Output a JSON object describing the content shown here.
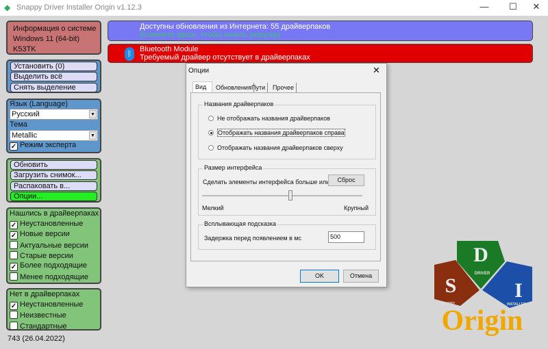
{
  "window": {
    "title": "Snappy Driver Installer Origin v1.12.3",
    "minimize": "—",
    "maximize": "☐",
    "close": "✕"
  },
  "sysinfo": {
    "title": "Информация о системе",
    "os": "Windows 11 (64-bit)",
    "model": "K53TK"
  },
  "selection": {
    "install": "Установить (0)",
    "select_all": "Выделить всё",
    "deselect": "Снять выделение"
  },
  "settings": {
    "language_label": "Язык (Language)",
    "language": "Русский",
    "theme_label": "Тема",
    "theme": "Metallic",
    "expert_mode": "Режим эксперта",
    "expert_checked": true
  },
  "actions": {
    "refresh": "Обновить",
    "load_snapshot": "Загрузить снимок...",
    "extract": "Распаковать в...",
    "options": "Опции..."
  },
  "found": {
    "title": "Нашлись в драйверпаках",
    "items": [
      {
        "label": "Неустановленные",
        "checked": true
      },
      {
        "label": "Новые версии",
        "checked": true
      },
      {
        "label": "Актуальные версии",
        "checked": false
      },
      {
        "label": "Старые версии",
        "checked": false
      },
      {
        "label": "Более подходящие",
        "checked": true
      },
      {
        "label": "Менее подходящие",
        "checked": false
      }
    ]
  },
  "notfound": {
    "title": "Нет в драйверпаках",
    "items": [
      {
        "label": "Неустановленные",
        "checked": true
      },
      {
        "label": "Неизвестные",
        "checked": false
      },
      {
        "label": "Стандартные",
        "checked": false
      }
    ]
  },
  "footer": {
    "revision": "743 (26.04.2022)"
  },
  "updates": {
    "line1": "Доступны обновления из Интернета: 55 драйверпаков",
    "line2": "(Кликните здесь, чтобы начать загрузку)"
  },
  "device": {
    "name": "Bluetooth Module",
    "status": "Требуемый драйвер отсутствует в драйверпаках"
  },
  "dialog": {
    "title": "Опции",
    "close": "✕",
    "tabs": [
      "Вид",
      "Обновления",
      "Пути",
      "Прочее"
    ],
    "names_group": "Названия драйверпаков",
    "radios": [
      "Не отображать названия драйверпаков",
      "Отображать названия драйверпаков справа",
      "Отображать названия драйверпаков сверху"
    ],
    "selected_radio": 1,
    "size_group": "Размер интерфейса",
    "size_desc": "Сделать элементы интерфейса больше или мень",
    "reset": "Сброс",
    "small": "Мелкий",
    "large": "Крупный",
    "slider_value": 0.55,
    "tooltip_group": "Всплывающая подсказка",
    "delay_label": "Задержка перед появлением в мс",
    "delay_value": "500",
    "ok": "OK",
    "cancel": "Отмена"
  },
  "logo": {
    "letters": [
      "S",
      "D",
      "I"
    ],
    "words": [
      "SNAPPY",
      "DRIVER",
      "INSTALLER"
    ],
    "origin": "Origin"
  },
  "colors": {
    "info": "#c87474",
    "blue_panel": "#5f97cc",
    "green_panel": "#82c47a",
    "updates": "#7878f4",
    "device": "#e00000",
    "options_btn": "#22ee22"
  }
}
